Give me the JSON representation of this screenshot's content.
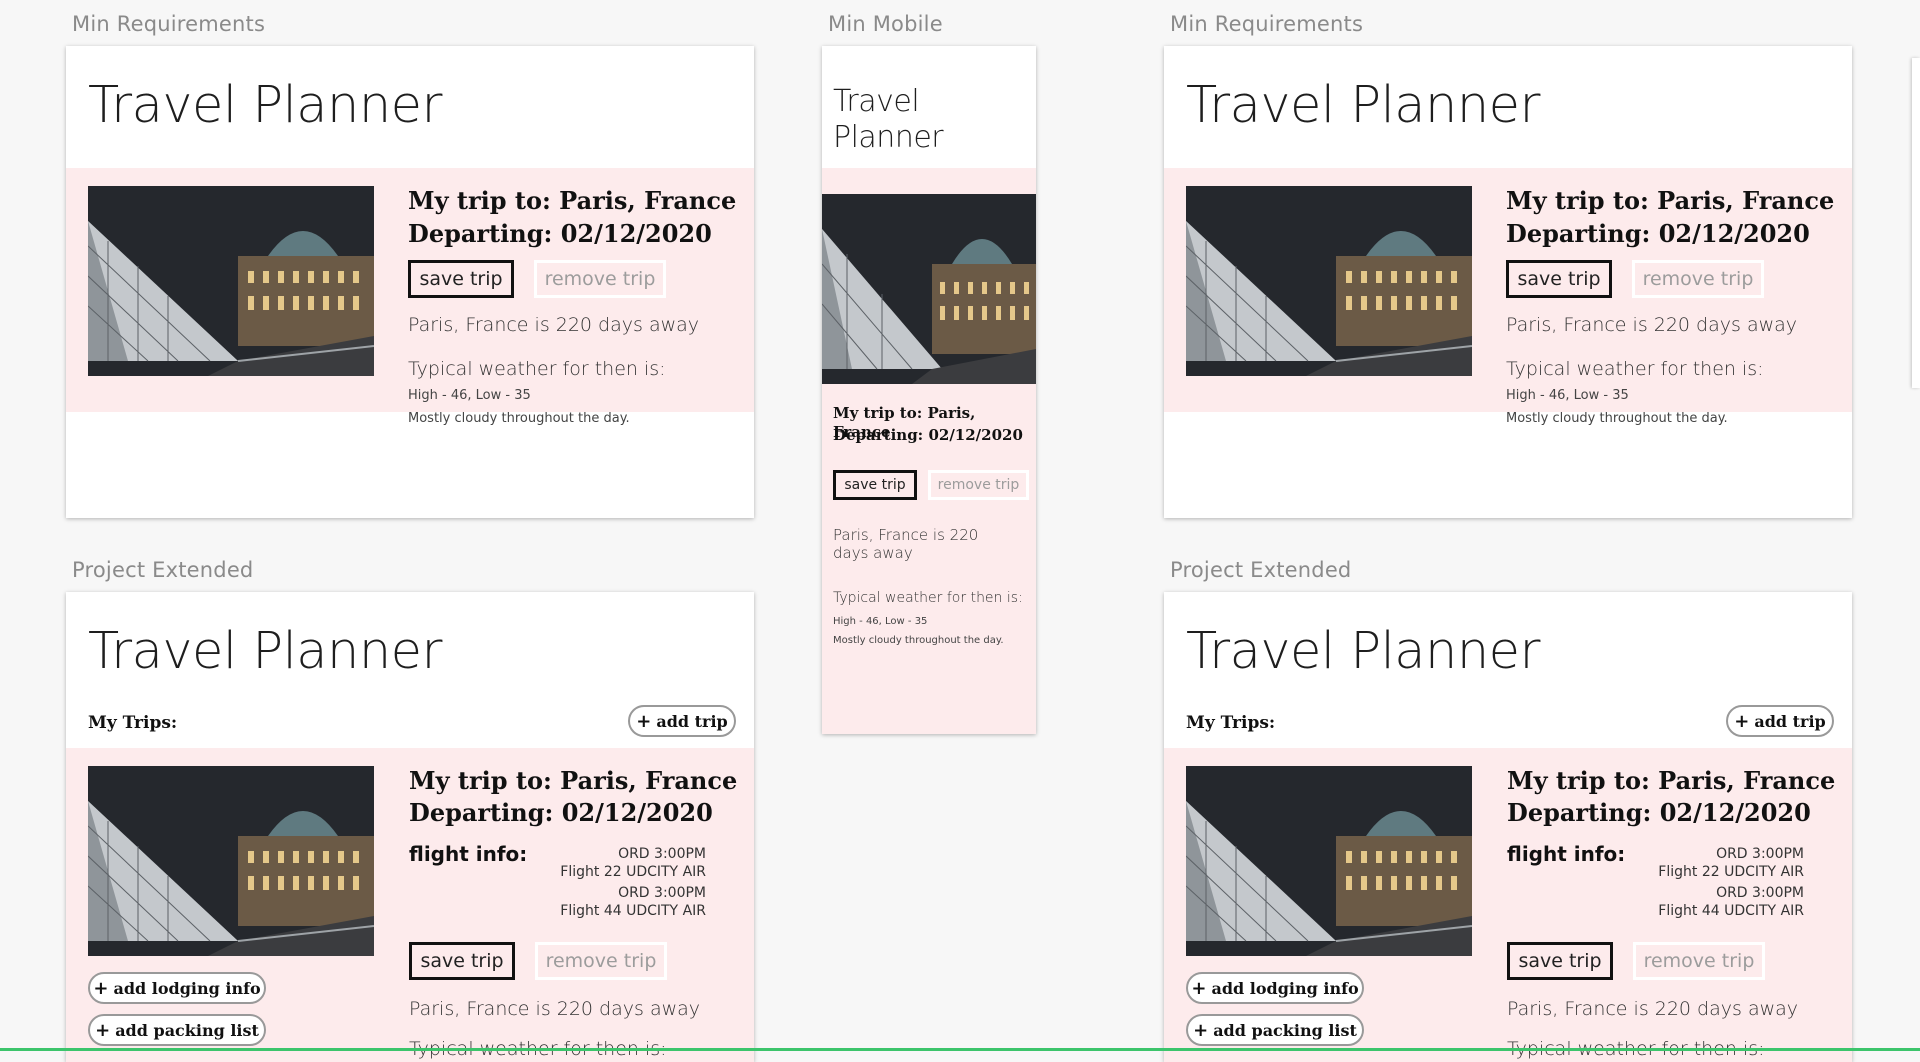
{
  "labels": {
    "min_requirements": "Min Requirements",
    "min_mobile": "Min Mobile",
    "project_extended": "Project Extended"
  },
  "app": {
    "title": "Travel Planner",
    "title_line1": "Travel",
    "title_line2": "Planner"
  },
  "trip": {
    "heading": "My trip to: Paris, France",
    "departing": "Departing: 02/12/2020",
    "save_label": "save trip",
    "remove_label": "remove trip",
    "countdown": "Paris, France is 220 days away",
    "countdown_line1": "Paris, France is 220",
    "countdown_line2": "days away",
    "weather_heading": "Typical weather for then is:",
    "weather_temps": "High - 46, Low - 35",
    "weather_summary": "Mostly cloudy throughout the day.",
    "photo_icon": "louvre-photo"
  },
  "extended": {
    "my_trips": "My Trips:",
    "add_trip": "add trip",
    "flight_label": "flight info:",
    "flights": [
      {
        "line1": "ORD 3:00PM",
        "line2": "Flight 22  UDCITY AIR"
      },
      {
        "line1": "ORD 3:00PM",
        "line2": "Flight 44  UDCITY AIR"
      }
    ],
    "add_lodging": "add lodging info",
    "add_packing": "add packing list",
    "plus_icon": "+"
  },
  "colors": {
    "pink_panel": "#fdebec",
    "background": "#f7f7f7",
    "accent_green": "#3cc46b"
  }
}
